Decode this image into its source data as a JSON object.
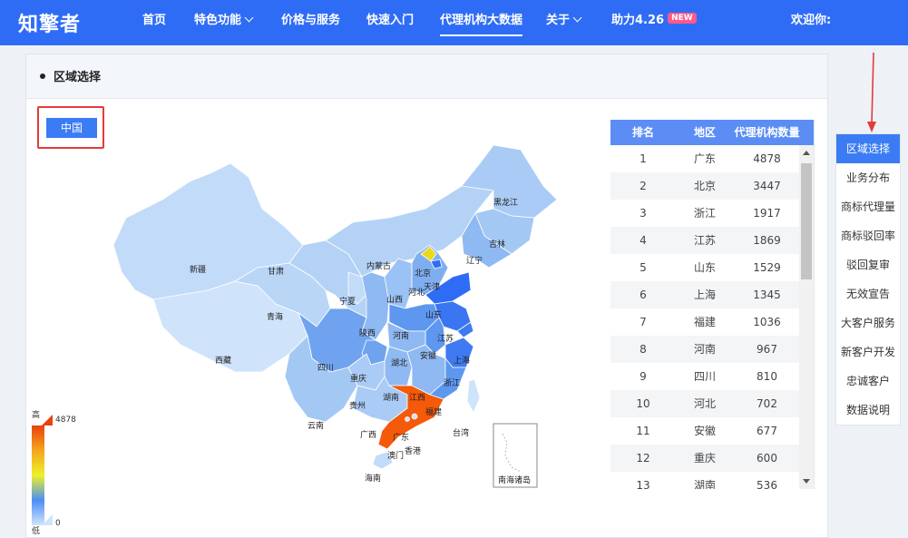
{
  "header": {
    "logo_text": "知擎者",
    "nav": [
      {
        "label": "首页"
      },
      {
        "label": "特色功能"
      },
      {
        "label": "价格与服务"
      },
      {
        "label": "快速入门"
      },
      {
        "label": "代理机构大数据"
      },
      {
        "label": "关于"
      },
      {
        "label": "助力4.26"
      }
    ],
    "new_badge": "NEW",
    "welcome": "欢迎你:"
  },
  "panel": {
    "title": "区域选择",
    "country_button": "中国"
  },
  "map": {
    "provinces": [
      "新疆",
      "西藏",
      "青海",
      "甘肃",
      "内蒙古",
      "宁夏",
      "山西",
      "北京",
      "天津",
      "河北",
      "辽宁",
      "吉林",
      "黑龙江",
      "山东",
      "陕西",
      "河南",
      "江苏",
      "上海",
      "安徽",
      "湖北",
      "四川",
      "重庆",
      "浙江",
      "湖南",
      "江西",
      "贵州",
      "福建",
      "云南",
      "广西",
      "广东",
      "香港",
      "澳门",
      "台湾",
      "海南"
    ],
    "inset_label": "南海诸岛",
    "legend": {
      "high_label": "高",
      "low_label": "低",
      "max": "4878",
      "min": "0"
    },
    "colors": {
      "high": "#e8410f",
      "highest_mid": "#eef02a",
      "mid": "#4b8ff5",
      "low": "#cfe4fb"
    }
  },
  "table": {
    "headers": [
      "排名",
      "地区",
      "代理机构数量"
    ],
    "rows": [
      {
        "rank": "1",
        "region": "广东",
        "count": "4878"
      },
      {
        "rank": "2",
        "region": "北京",
        "count": "3447"
      },
      {
        "rank": "3",
        "region": "浙江",
        "count": "1917"
      },
      {
        "rank": "4",
        "region": "江苏",
        "count": "1869"
      },
      {
        "rank": "5",
        "region": "山东",
        "count": "1529"
      },
      {
        "rank": "6",
        "region": "上海",
        "count": "1345"
      },
      {
        "rank": "7",
        "region": "福建",
        "count": "1036"
      },
      {
        "rank": "8",
        "region": "河南",
        "count": "967"
      },
      {
        "rank": "9",
        "region": "四川",
        "count": "810"
      },
      {
        "rank": "10",
        "region": "河北",
        "count": "702"
      },
      {
        "rank": "11",
        "region": "安徽",
        "count": "677"
      },
      {
        "rank": "12",
        "region": "重庆",
        "count": "600"
      },
      {
        "rank": "13",
        "region": "湖南",
        "count": "536"
      }
    ]
  },
  "side_menu": {
    "items": [
      "区域选择",
      "业务分布",
      "商标代理量",
      "商标驳回率",
      "驳回复审",
      "无效宣告",
      "大客户服务",
      "新客户开发",
      "忠诚客户",
      "数据说明"
    ]
  }
}
